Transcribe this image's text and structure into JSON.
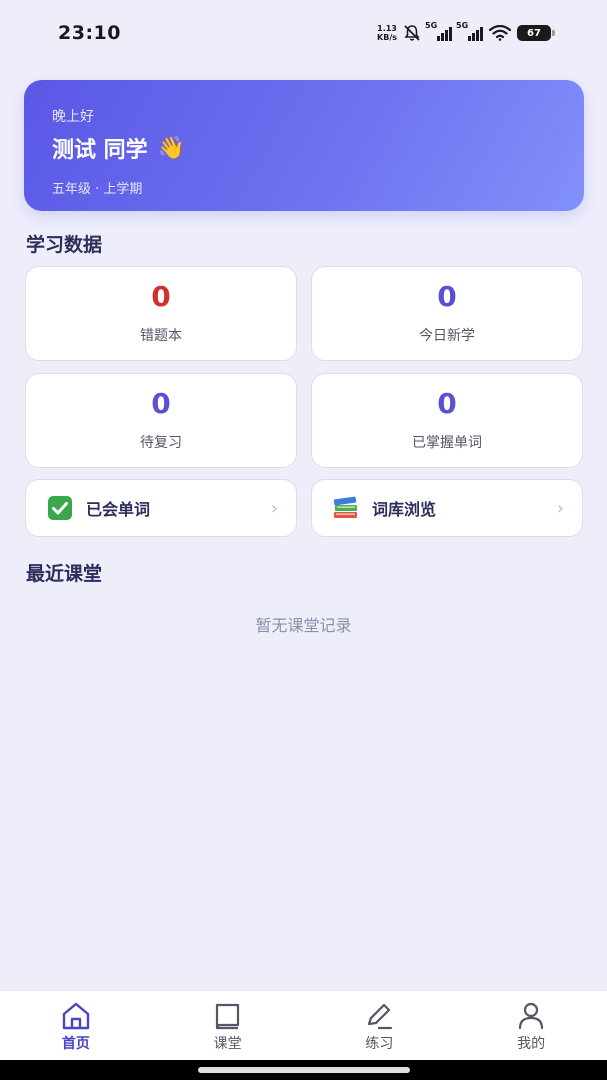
{
  "status": {
    "time": "23:10",
    "net_speed_value": "1.13",
    "net_speed_unit": "KB/s",
    "signal1": "5G",
    "signal2": "5G",
    "battery": "67"
  },
  "hero": {
    "greeting": "晚上好",
    "name": "测试 同学",
    "emoji": "👋",
    "grade": "五年级 · 上学期"
  },
  "stats_section": {
    "title": "学习数据",
    "cards": [
      {
        "value": "0",
        "label": "错题本"
      },
      {
        "value": "0",
        "label": "今日新学"
      },
      {
        "value": "0",
        "label": "待复习"
      },
      {
        "value": "0",
        "label": "已掌握单词"
      }
    ]
  },
  "links": [
    {
      "label": "已会单词",
      "icon": "check-icon",
      "chevron": "›"
    },
    {
      "label": "词库浏览",
      "icon": "books-icon",
      "chevron": "›"
    }
  ],
  "recent_section": {
    "title": "最近课堂",
    "empty_text": "暂无课堂记录"
  },
  "nav": [
    {
      "label": "首页",
      "icon": "home-icon",
      "active": true
    },
    {
      "label": "课堂",
      "icon": "book-icon",
      "active": false
    },
    {
      "label": "练习",
      "icon": "pen-icon",
      "active": false
    },
    {
      "label": "我的",
      "icon": "user-icon",
      "active": false
    }
  ],
  "colors": {
    "accent": "#5b4fd6",
    "error": "#d32f2f",
    "background": "#eeeefb"
  }
}
